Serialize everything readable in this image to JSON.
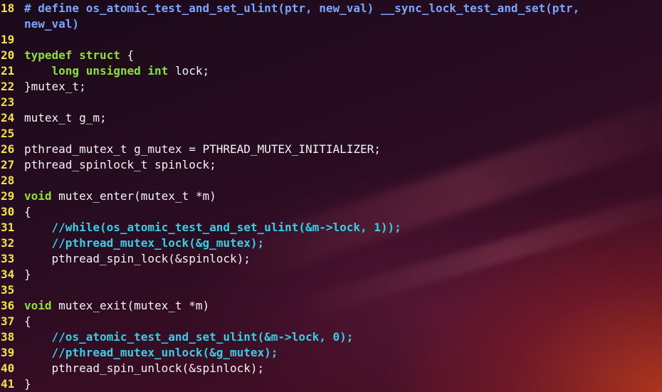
{
  "lines": [
    {
      "num": "18",
      "segments": [
        {
          "t": "pp",
          "v": "# define os_atomic_test_and_set_ulint(ptr, new_val) __sync_lock_test_and_set(ptr,"
        }
      ]
    },
    {
      "num": "",
      "segments": [
        {
          "t": "pp",
          "v": "new_val)"
        }
      ]
    },
    {
      "num": "19",
      "segments": []
    },
    {
      "num": "20",
      "segments": [
        {
          "t": "kw",
          "v": "typedef"
        },
        {
          "t": "pl",
          "v": " "
        },
        {
          "t": "kw",
          "v": "struct"
        },
        {
          "t": "pl",
          "v": " {"
        }
      ]
    },
    {
      "num": "21",
      "segments": [
        {
          "t": "pl",
          "v": "    "
        },
        {
          "t": "kw",
          "v": "long"
        },
        {
          "t": "pl",
          "v": " "
        },
        {
          "t": "kw",
          "v": "unsigned"
        },
        {
          "t": "pl",
          "v": " "
        },
        {
          "t": "kw",
          "v": "int"
        },
        {
          "t": "pl",
          "v": " lock;"
        }
      ]
    },
    {
      "num": "22",
      "segments": [
        {
          "t": "pl",
          "v": "}mutex_t;"
        }
      ]
    },
    {
      "num": "23",
      "segments": []
    },
    {
      "num": "24",
      "segments": [
        {
          "t": "pl",
          "v": "mutex_t g_m;"
        }
      ]
    },
    {
      "num": "25",
      "segments": []
    },
    {
      "num": "26",
      "segments": [
        {
          "t": "pl",
          "v": "pthread_mutex_t g_mutex = PTHREAD_MUTEX_INITIALIZER;"
        }
      ]
    },
    {
      "num": "27",
      "segments": [
        {
          "t": "pl",
          "v": "pthread_spinlock_t spinlock;"
        }
      ]
    },
    {
      "num": "28",
      "segments": []
    },
    {
      "num": "29",
      "segments": [
        {
          "t": "kw",
          "v": "void"
        },
        {
          "t": "pl",
          "v": " mutex_enter(mutex_t *m)"
        }
      ]
    },
    {
      "num": "30",
      "segments": [
        {
          "t": "pl",
          "v": "{"
        }
      ]
    },
    {
      "num": "31",
      "segments": [
        {
          "t": "pl",
          "v": "    "
        },
        {
          "t": "cm",
          "v": "//while(os_atomic_test_and_set_ulint(&m->lock, 1));"
        }
      ]
    },
    {
      "num": "32",
      "segments": [
        {
          "t": "pl",
          "v": "    "
        },
        {
          "t": "cm",
          "v": "//pthread_mutex_lock(&g_mutex);"
        }
      ]
    },
    {
      "num": "33",
      "segments": [
        {
          "t": "pl",
          "v": "    pthread_spin_lock(&spinlock);"
        }
      ]
    },
    {
      "num": "34",
      "segments": [
        {
          "t": "pl",
          "v": "}"
        }
      ]
    },
    {
      "num": "35",
      "segments": []
    },
    {
      "num": "36",
      "segments": [
        {
          "t": "kw",
          "v": "void"
        },
        {
          "t": "pl",
          "v": " mutex_exit(mutex_t *m)"
        }
      ]
    },
    {
      "num": "37",
      "segments": [
        {
          "t": "pl",
          "v": "{"
        }
      ]
    },
    {
      "num": "38",
      "segments": [
        {
          "t": "pl",
          "v": "    "
        },
        {
          "t": "cm",
          "v": "//os_atomic_test_and_set_ulint(&m->lock, 0);"
        }
      ]
    },
    {
      "num": "39",
      "segments": [
        {
          "t": "pl",
          "v": "    "
        },
        {
          "t": "cm",
          "v": "//pthread_mutex_unlock(&g_mutex);"
        }
      ]
    },
    {
      "num": "40",
      "segments": [
        {
          "t": "pl",
          "v": "    pthread_spin_unlock(&spinlock);"
        }
      ]
    },
    {
      "num": "41",
      "segments": [
        {
          "t": "pl",
          "v": "}"
        }
      ]
    }
  ],
  "colors": {
    "line_number": "#f2e44a",
    "keyword": "#8ae234",
    "comment": "#34d0e6",
    "preprocessor": "#7aa6ff",
    "text": "#f4f4f4"
  }
}
